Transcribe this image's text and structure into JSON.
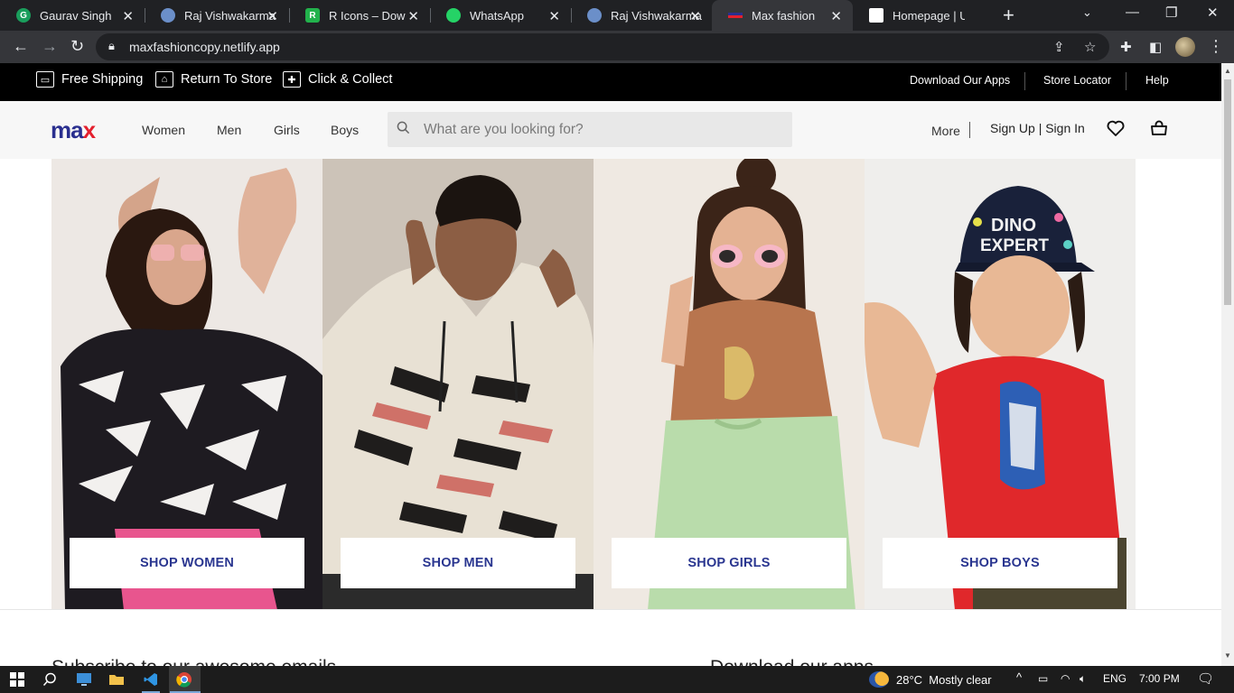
{
  "browser": {
    "tabs": [
      {
        "title": "Gaurav Singh",
        "favicon_color": "#1a9e5c",
        "favicon_letter": "G"
      },
      {
        "title": "Raj Vishwakarma",
        "favicon_color": "#6b8fc9",
        "favicon_letter": ""
      },
      {
        "title": "R Icons – Downlo",
        "favicon_color": "#22b24c",
        "favicon_letter": "R"
      },
      {
        "title": "WhatsApp",
        "favicon_color": "#25d366",
        "favicon_letter": ""
      },
      {
        "title": "Raj Vishwakarma",
        "favicon_color": "#6b8fc9",
        "favicon_letter": ""
      },
      {
        "title": "Max fashion",
        "favicon_color": "#e4202e",
        "favicon_letter": ""
      },
      {
        "title": "Homepage | Uns",
        "favicon_color": "#ffffff",
        "favicon_letter": ""
      }
    ],
    "active_tab_index": 5,
    "url": "maxfashioncopy.netlify.app"
  },
  "promo_bar": {
    "left_items": [
      "Free Shipping",
      "Return To Store",
      "Click & Collect"
    ],
    "right_links": [
      "Download Our Apps",
      "Store Locator",
      "Help"
    ]
  },
  "header": {
    "logo_main": "ma",
    "logo_accent": "x",
    "nav": [
      "Women",
      "Men",
      "Girls",
      "Boys"
    ],
    "search_placeholder": "What are you looking for?",
    "more": "More",
    "signin": "Sign Up | Sign In",
    "brand_blue": "#2a2f8f",
    "brand_red": "#e4202e"
  },
  "hero": {
    "panels": [
      {
        "button": "SHOP WOMEN"
      },
      {
        "button": "SHOP MEN"
      },
      {
        "button": "SHOP GIRLS"
      },
      {
        "button": "SHOP BOYS"
      }
    ],
    "button_text_color": "#2a3690"
  },
  "footer_preview": {
    "subscribe_title": "Subscribe to our awesome emails",
    "download_title": "Download our apps"
  },
  "taskbar": {
    "weather": "28°C  Mostly clear",
    "language": "ENG",
    "time": "7:00 PM"
  }
}
